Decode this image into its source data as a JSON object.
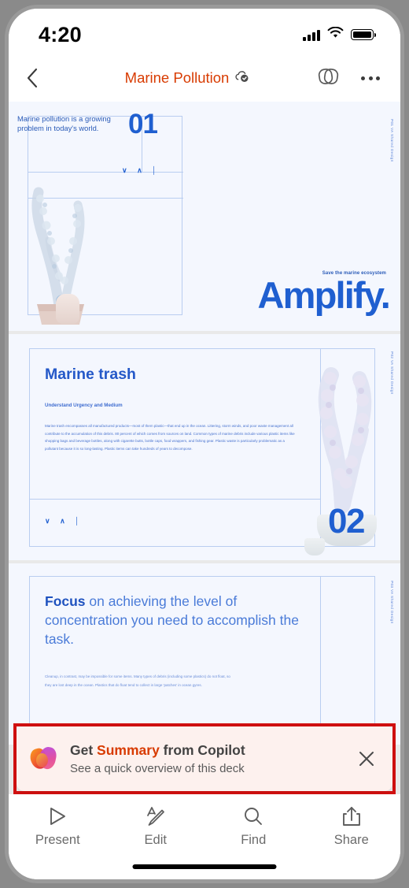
{
  "statusbar": {
    "time": "4:20",
    "cellular_icon": "signal-bars-icon",
    "wifi_icon": "wifi-icon",
    "battery_icon": "battery-icon"
  },
  "navbar": {
    "back_icon": "chevron-left-icon",
    "title": "Marine Pollution",
    "sync_icon": "cloud-synced-icon",
    "loop_icon": "loop-pages-icon",
    "more_icon": "more-options-icon"
  },
  "deck": {
    "selected_slide_index": 0,
    "slides": [
      {
        "number": "01",
        "quote": "Marine pollution is a growing problem in today's world.",
        "chevrons": "∨ ∧  │",
        "tagline": "Save the marine ecosystem",
        "wordmark": "Amplify.",
        "side_label": "P01  VA Shared Design"
      },
      {
        "number": "02",
        "title": "Marine trash",
        "subtitle": "Understand Urgency and Medium",
        "body": "Marine trash encompasses all manufactured products—most of them plastic—that end up in the ocean. Littering, storm winds, and poor waste management all contribute to the accumulation of this debris. 80 percent of which comes from sources on land. Common types of marine debris include various plastic items like shopping bags and beverage bottles, along with cigarette butts, bottle caps, food wrappers, and fishing gear. Plastic waste is particularly problematic as a pollutant because it is so long-lasting. Plastic items can take hundreds of years to decompose.",
        "chevrons": "∨ ∧  │",
        "side_label": "P02  VA Shared Design"
      },
      {
        "heading_bold": "Focus",
        "heading_rest": " on achieving the level of concentration you need to accomplish the task.",
        "body": "Cleanup, in contrast, may be impossible for some items. Many types of debris (including some plastics) do not float, so they are lost deep in the ocean. Plastics that do float tend to collect in large 'patches' in ocean gyres.",
        "side_label": "P03  VA Shared Design"
      }
    ]
  },
  "banner": {
    "icon": "copilot-icon",
    "title_prefix": "Get ",
    "title_accent": "Summary",
    "title_suffix": " from Copilot",
    "subtitle": "See a quick overview of this deck",
    "close_icon": "close-icon",
    "accent_color": "#d83b01"
  },
  "toolbar": {
    "items": [
      {
        "label": "Present",
        "icon": "play-triangle-icon"
      },
      {
        "label": "Edit",
        "icon": "text-pencil-icon"
      },
      {
        "label": "Find",
        "icon": "search-icon"
      },
      {
        "label": "Share",
        "icon": "share-upload-icon"
      }
    ]
  }
}
